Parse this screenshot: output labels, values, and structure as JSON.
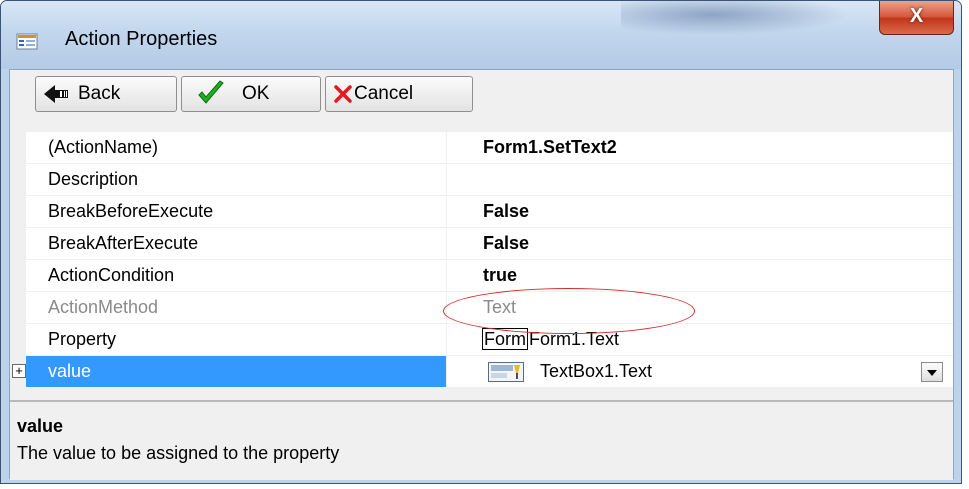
{
  "window": {
    "title": "Action Properties",
    "close_glyph": "X"
  },
  "toolbar": {
    "back_label": "Back",
    "ok_label": "OK",
    "cancel_label": "Cancel"
  },
  "grid": {
    "rows": [
      {
        "name": "(ActionName)",
        "value": "Form1.SetText2"
      },
      {
        "name": "Description",
        "value": ""
      },
      {
        "name": "BreakBeforeExecute",
        "value": "False"
      },
      {
        "name": "BreakAfterExecute",
        "value": "False"
      },
      {
        "name": "ActionCondition",
        "value": "true"
      },
      {
        "name": "ActionMethod",
        "value": "Text"
      },
      {
        "name": "Property",
        "value_box": "Form",
        "value": "Form1.Text"
      },
      {
        "name": "value",
        "value": "TextBox1.Text",
        "expander": "+"
      }
    ]
  },
  "description": {
    "title": "value",
    "text": "The value to be assigned to the property"
  },
  "colors": {
    "selection": "#3399ff",
    "highlight_ellipse": "#d42c2c",
    "close_button": "#c2351b",
    "ok_check": "#1fae1f",
    "cancel_x": "#e01b1b"
  },
  "icons": {
    "app": "properties-window-icon",
    "back": "back-arrow-icon",
    "ok": "checkmark-icon",
    "cancel": "red-x-icon",
    "value_type": "textbox-icon"
  }
}
